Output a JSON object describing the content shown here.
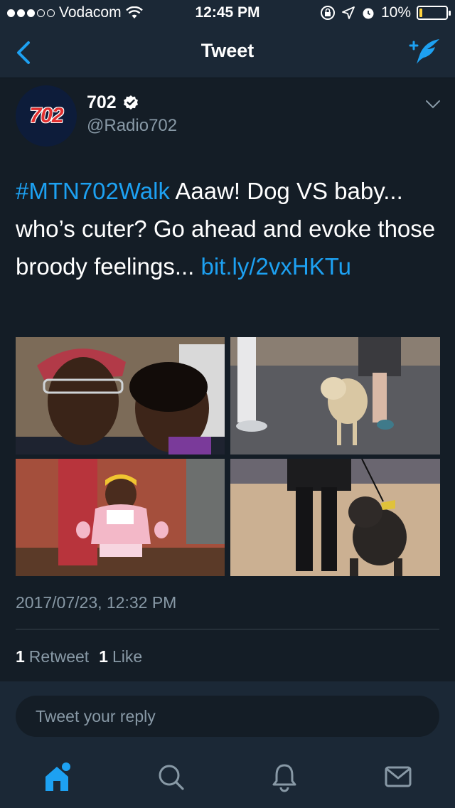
{
  "status_bar": {
    "carrier": "Vodacom",
    "time": "12:45 PM",
    "battery_percent": "10%",
    "battery_level": 0.1,
    "signal_bars_filled": 3,
    "signal_bars_total": 5,
    "icons": [
      "wifi-icon",
      "lock-rotation-icon",
      "location-icon",
      "alarm-icon",
      "battery-icon"
    ]
  },
  "nav": {
    "title": "Tweet",
    "back_icon": "chevron-left-icon",
    "compose_icon": "compose-tweet-icon"
  },
  "tweet": {
    "avatar_text": "702",
    "display_name": "702",
    "verified": true,
    "handle": "@Radio702",
    "hashtag": "#MTN702Walk",
    "body": " Aaaw! Dog VS baby... who’s cuter? Go ahead and evoke those broody feelings... ",
    "link": "bit.ly/2vxHKTu",
    "timestamp": "2017/07/23, 12:32 PM",
    "retweet_count": "1",
    "retweet_label": "Retweet",
    "like_count": "1",
    "like_label": "Like",
    "media": [
      "man-and-child-selfie",
      "dog-on-leash-walk",
      "toddler-in-pink",
      "pitbull-on-leash"
    ]
  },
  "reply": {
    "placeholder": "Tweet your reply"
  },
  "tab_bar": {
    "items": [
      "home-icon",
      "search-icon",
      "notifications-icon",
      "messages-icon"
    ],
    "active": "home-icon"
  },
  "colors": {
    "background": "#141d26",
    "bar_background": "#1b2836",
    "accent": "#1da1f2",
    "secondary_text": "#8899a6"
  }
}
